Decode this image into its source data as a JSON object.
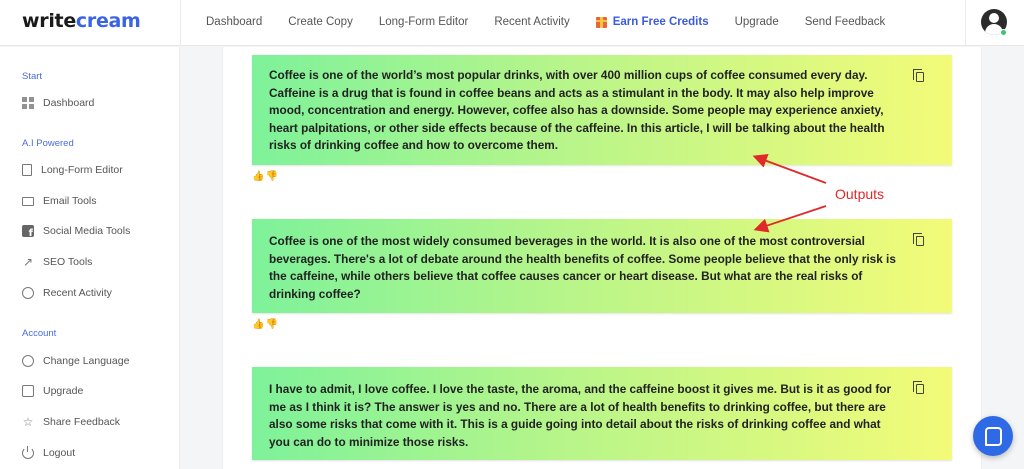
{
  "brand": {
    "logo_dark": "write",
    "logo_accent": "cream"
  },
  "nav": {
    "items": [
      "Dashboard",
      "Create Copy",
      "Long-Form Editor",
      "Recent Activity"
    ],
    "credits": "Earn Free Credits",
    "items2": [
      "Upgrade",
      "Send Feedback"
    ]
  },
  "sidebar": {
    "start_title": "Start",
    "dashboard": "Dashboard",
    "ai_title": "A.I Powered",
    "long_form": "Long-Form Editor",
    "email": "Email Tools",
    "social": "Social Media Tools",
    "seo": "SEO Tools",
    "recent": "Recent Activity",
    "account_title": "Account",
    "language": "Change Language",
    "upgrade": "Upgrade",
    "feedback": "Share Feedback",
    "logout": "Logout"
  },
  "outputs": [
    "Coffee is one of the world’s most popular drinks, with over 400 million cups of coffee consumed every day. Caffeine is a drug that is found in coffee beans and acts as a stimulant in the body. It may also help improve mood, concentration and energy. However, coffee also has a downside. Some people may experience anxiety, heart palpitations, or other side effects because of the caffeine. In this article, I will be talking about the health risks of drinking coffee and how to overcome them.",
    "Coffee is one of the most widely consumed beverages in the world. It is also one of the most controversial beverages. There's a lot of debate around the health benefits of coffee. Some people believe that the only risk is the caffeine, while others believe that coffee causes cancer or heart disease. But what are the real risks of drinking coffee?",
    "I have to admit, I love coffee. I love the taste, the aroma, and the caffeine boost it gives me. But is it as good for me as I think it is? The answer is yes and no. There are a lot of health benefits to drinking coffee, but there are also some risks that come with it. This is a guide going into detail about the risks of drinking coffee and what you can do to minimize those risks."
  ],
  "annotation": {
    "label": "Outputs",
    "color": "#e02a2a"
  },
  "colors": {
    "accent": "#3b5bdb",
    "card_left": "#7ef29a",
    "card_right": "#f3fb78",
    "chat": "#2f6ae6"
  }
}
